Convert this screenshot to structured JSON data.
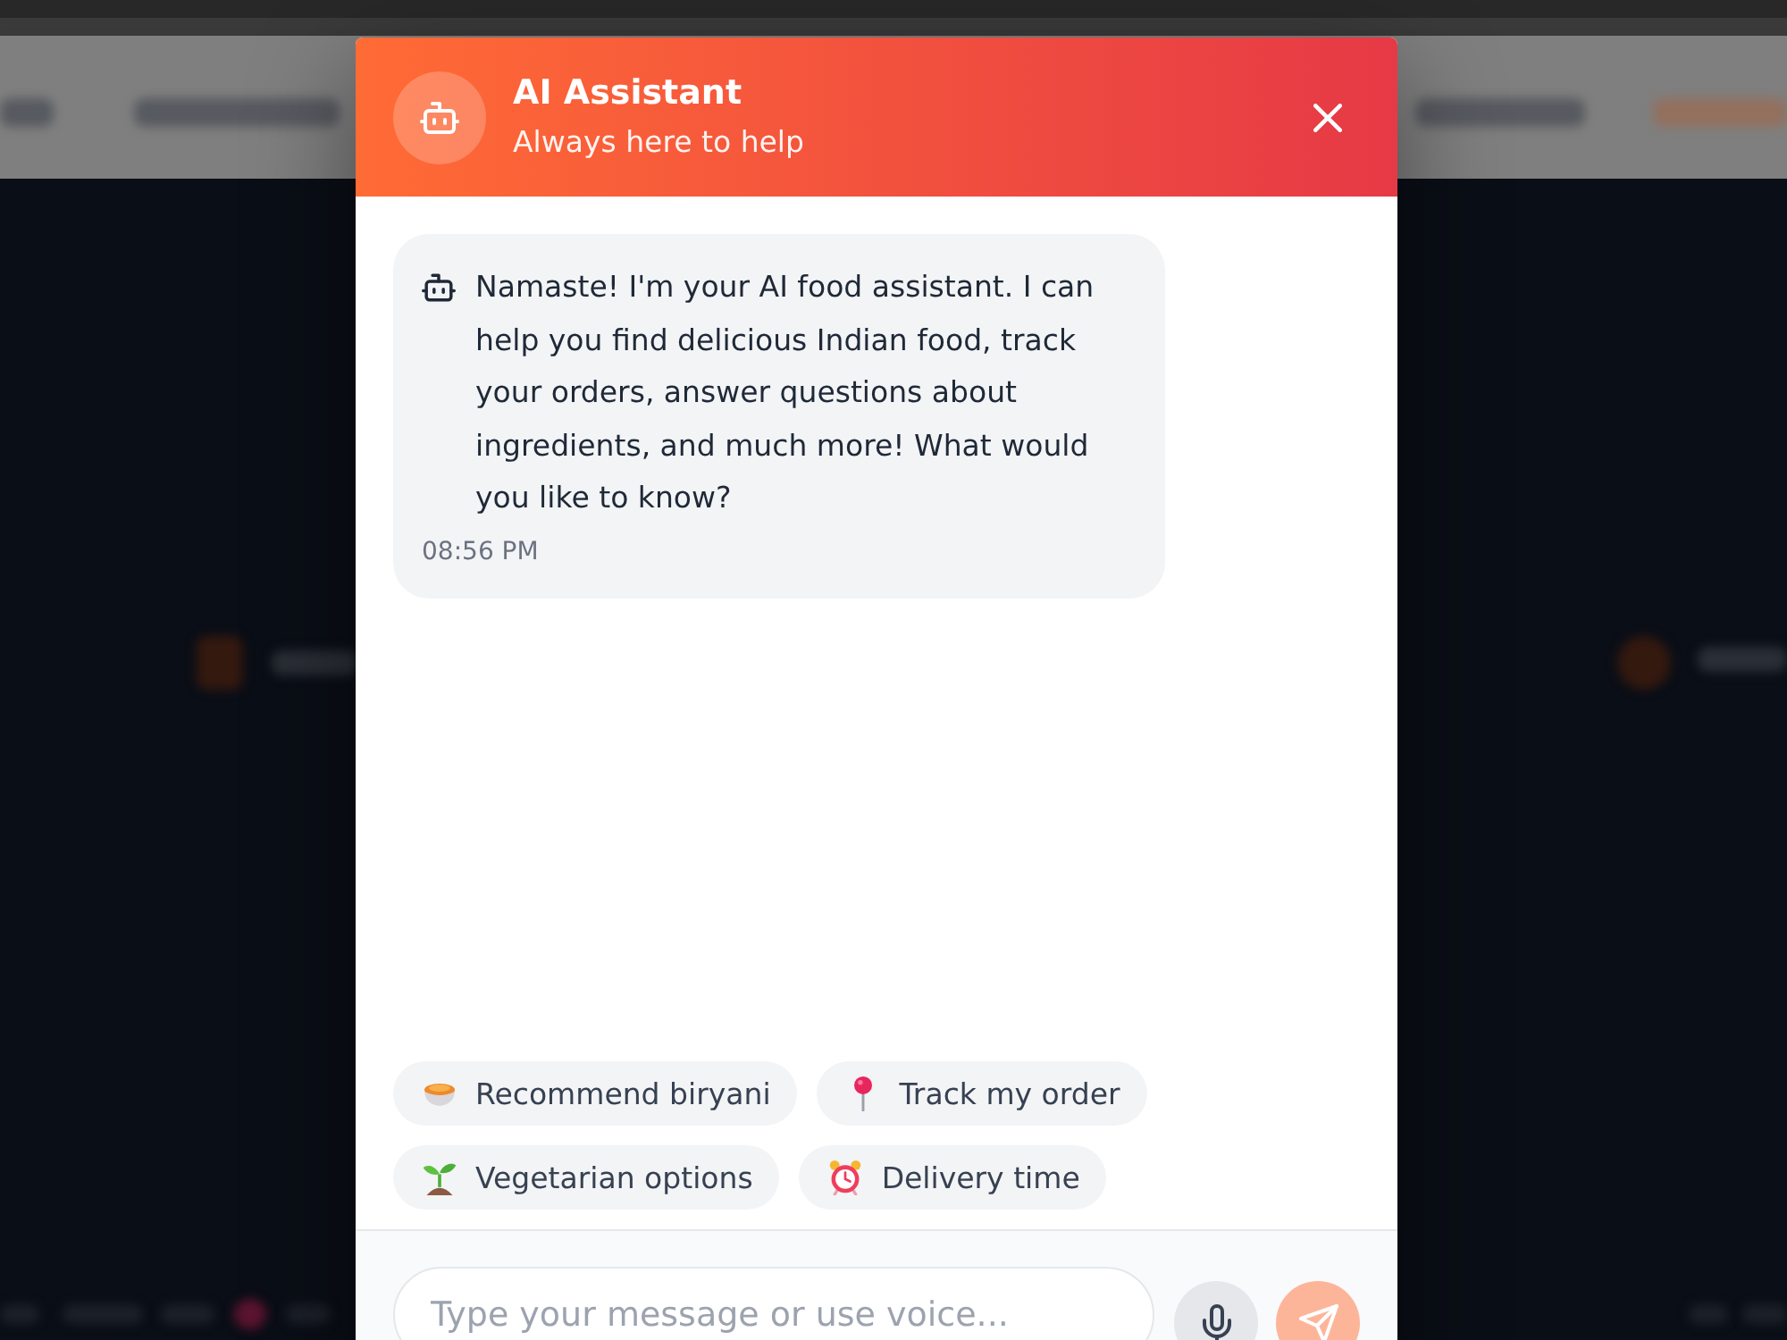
{
  "chat_panel": {
    "title": "AI Assistant",
    "subtitle": "Always here to help"
  },
  "messages": [
    {
      "kind": "bot",
      "text": "Namaste! I'm your AI food assistant. I can help you find delicious Indian food, track your orders, answer questions about ingredients, and much more! What would you like to know?",
      "time": "08:56 PM"
    }
  ],
  "quick_replies": [
    {
      "label": "Recommend biryani"
    },
    {
      "label": "Track my order"
    },
    {
      "label": "Vegetarian options"
    },
    {
      "label": "Delivery time"
    }
  ],
  "composer": {
    "placeholder": "Type your message or use voice...",
    "send_disabled": true
  }
}
